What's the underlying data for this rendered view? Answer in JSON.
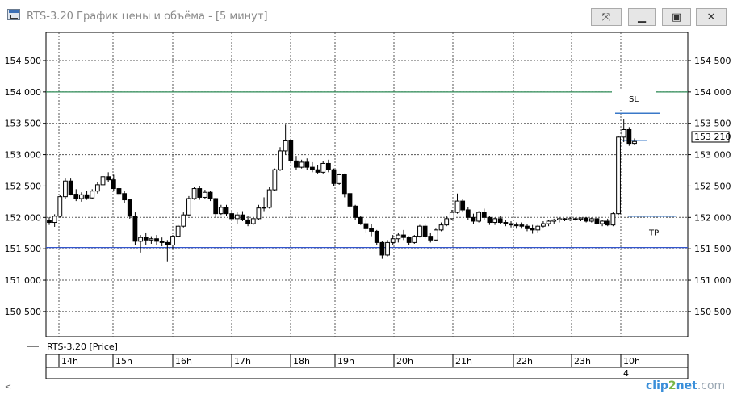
{
  "window": {
    "title": "RTS-3.20 График цены и объёма - [5 минут]",
    "buttons": {
      "pin": "⤧",
      "minimize": "▁",
      "maximize": "▣",
      "close": "✕"
    }
  },
  "legend": {
    "series_label": "RTS-3.20 [Price]"
  },
  "footer": {
    "bottom_label": "4"
  },
  "watermark": {
    "part1": "clip",
    "part2": "2",
    "part3": "net",
    "part4": ".com"
  },
  "chart_data": {
    "type": "candlestick",
    "y_ticks": [
      150500,
      151000,
      151500,
      152000,
      152500,
      153000,
      153500,
      154000,
      154500
    ],
    "y_tick_labels": [
      "150 500",
      "151 000",
      "151 500",
      "152 000",
      "152 500",
      "153 000",
      "153 500",
      "154 000",
      "154 500"
    ],
    "ylim": [
      150100,
      154950
    ],
    "grid": true,
    "x_sessions": [
      "14h",
      "15h",
      "16h",
      "17h",
      "18h",
      "19h",
      "20h",
      "21h",
      "22h",
      "23h",
      "10h"
    ],
    "last_price": 153210,
    "last_price_label": "153 210",
    "reference_lines": [
      {
        "name": "green-level",
        "value": 154000,
        "color": "#2e8b57"
      },
      {
        "name": "blue-level",
        "value": 151520,
        "color": "#3355cc"
      }
    ],
    "order_levels": [
      {
        "label": "SL",
        "value": 153660,
        "color": "#3a78c8"
      },
      {
        "label": "",
        "value": 153230,
        "color": "#3a78c8"
      },
      {
        "label": "TP",
        "value": 152020,
        "color": "#3a78c8"
      }
    ],
    "candles": [
      [
        151950,
        152000,
        151880,
        151920
      ],
      [
        151920,
        152050,
        151850,
        152020
      ],
      [
        152020,
        152360,
        152000,
        152330
      ],
      [
        152330,
        152620,
        152300,
        152580
      ],
      [
        152580,
        152620,
        152350,
        152370
      ],
      [
        152370,
        152450,
        152260,
        152300
      ],
      [
        152300,
        152400,
        152250,
        152360
      ],
      [
        152360,
        152420,
        152280,
        152310
      ],
      [
        152310,
        152450,
        152300,
        152420
      ],
      [
        152420,
        152560,
        152380,
        152520
      ],
      [
        152520,
        152690,
        152480,
        152650
      ],
      [
        152650,
        152720,
        152560,
        152600
      ],
      [
        152600,
        152680,
        152420,
        152460
      ],
      [
        152460,
        152500,
        152340,
        152380
      ],
      [
        152380,
        152420,
        152230,
        152280
      ],
      [
        152280,
        152300,
        151980,
        152020
      ],
      [
        152020,
        152080,
        151560,
        151620
      ],
      [
        151620,
        151720,
        151440,
        151680
      ],
      [
        151680,
        151760,
        151560,
        151640
      ],
      [
        151640,
        151700,
        151580,
        151660
      ],
      [
        151660,
        151720,
        151560,
        151620
      ],
      [
        151620,
        151680,
        151540,
        151600
      ],
      [
        151600,
        151640,
        151300,
        151560
      ],
      [
        151560,
        151720,
        151500,
        151700
      ],
      [
        151700,
        151880,
        151680,
        151860
      ],
      [
        151860,
        152080,
        151840,
        152040
      ],
      [
        152040,
        152340,
        152020,
        152300
      ],
      [
        152300,
        152480,
        152280,
        152460
      ],
      [
        152460,
        152500,
        152280,
        152320
      ],
      [
        152320,
        152440,
        152300,
        152400
      ],
      [
        152400,
        152420,
        152260,
        152300
      ],
      [
        152300,
        152310,
        152000,
        152060
      ],
      [
        152060,
        152200,
        152040,
        152160
      ],
      [
        152160,
        152200,
        152020,
        152060
      ],
      [
        152060,
        152100,
        151960,
        151980
      ],
      [
        151980,
        152080,
        151900,
        152040
      ],
      [
        152040,
        152100,
        151940,
        151960
      ],
      [
        151960,
        152020,
        151860,
        151900
      ],
      [
        151900,
        152000,
        151880,
        151980
      ],
      [
        151980,
        152200,
        151960,
        152150
      ],
      [
        152150,
        152320,
        152100,
        152160
      ],
      [
        152160,
        152480,
        152140,
        152440
      ],
      [
        152440,
        152780,
        152420,
        152760
      ],
      [
        152760,
        153120,
        152740,
        153060
      ],
      [
        153060,
        153480,
        153000,
        153220
      ],
      [
        153220,
        153260,
        152860,
        152900
      ],
      [
        152900,
        152980,
        152760,
        152800
      ],
      [
        152800,
        152920,
        152780,
        152880
      ],
      [
        152880,
        152940,
        152760,
        152800
      ],
      [
        152800,
        152880,
        152720,
        152760
      ],
      [
        152760,
        152840,
        152700,
        152720
      ],
      [
        152720,
        152900,
        152700,
        152860
      ],
      [
        152860,
        152920,
        152720,
        152760
      ],
      [
        152760,
        152780,
        152500,
        152540
      ],
      [
        152540,
        152700,
        152520,
        152680
      ],
      [
        152680,
        152700,
        152320,
        152380
      ],
      [
        152380,
        152420,
        152140,
        152180
      ],
      [
        152180,
        152200,
        151960,
        152000
      ],
      [
        152000,
        152020,
        151880,
        151900
      ],
      [
        151900,
        151960,
        151760,
        151820
      ],
      [
        151820,
        151900,
        151700,
        151780
      ],
      [
        151780,
        151800,
        151560,
        151600
      ],
      [
        151600,
        151620,
        151340,
        151400
      ],
      [
        151400,
        151640,
        151380,
        151600
      ],
      [
        151600,
        151720,
        151560,
        151660
      ],
      [
        151660,
        151760,
        151600,
        151720
      ],
      [
        151720,
        151800,
        151640,
        151680
      ],
      [
        151680,
        151700,
        151560,
        151600
      ],
      [
        151600,
        151720,
        151580,
        151700
      ],
      [
        151700,
        151880,
        151680,
        151860
      ],
      [
        151860,
        151900,
        151660,
        151700
      ],
      [
        151700,
        151760,
        151600,
        151640
      ],
      [
        151640,
        151820,
        151620,
        151800
      ],
      [
        151800,
        151920,
        151780,
        151880
      ],
      [
        151880,
        152020,
        151860,
        151980
      ],
      [
        151980,
        152120,
        151960,
        152080
      ],
      [
        152080,
        152380,
        152060,
        152260
      ],
      [
        152260,
        152300,
        152080,
        152120
      ],
      [
        152120,
        152160,
        151960,
        152000
      ],
      [
        152000,
        152060,
        151900,
        151940
      ],
      [
        151940,
        152100,
        151920,
        152080
      ],
      [
        152080,
        152140,
        151960,
        152000
      ],
      [
        152000,
        152020,
        151880,
        151920
      ],
      [
        151920,
        152000,
        151880,
        151980
      ],
      [
        151980,
        152020,
        151900,
        151920
      ],
      [
        151920,
        151960,
        151860,
        151900
      ],
      [
        151900,
        151940,
        151840,
        151880
      ],
      [
        151880,
        151920,
        151820,
        151880
      ],
      [
        151880,
        151920,
        151820,
        151860
      ],
      [
        151860,
        151900,
        151780,
        151820
      ],
      [
        151820,
        151880,
        151740,
        151800
      ],
      [
        151800,
        151880,
        151760,
        151860
      ],
      [
        151860,
        151940,
        151840,
        151900
      ],
      [
        151900,
        151960,
        151860,
        151940
      ],
      [
        151940,
        151980,
        151900,
        151960
      ],
      [
        151960,
        152000,
        151920,
        151980
      ],
      [
        151980,
        151990,
        151940,
        151960
      ],
      [
        151960,
        152000,
        151940,
        151980
      ],
      [
        151980,
        152000,
        151950,
        151970
      ],
      [
        151970,
        152000,
        151940,
        151990
      ],
      [
        151990,
        152000,
        151920,
        151940
      ],
      [
        151940,
        152000,
        151920,
        151980
      ],
      [
        151980,
        151990,
        151880,
        151900
      ],
      [
        151900,
        151960,
        151860,
        151940
      ],
      [
        151940,
        151980,
        151860,
        151880
      ],
      [
        151880,
        152080,
        151860,
        152060
      ],
      [
        152060,
        153300,
        152040,
        153280
      ],
      [
        153280,
        153560,
        153200,
        153400
      ],
      [
        153400,
        153440,
        153140,
        153180
      ],
      [
        153180,
        153260,
        153160,
        153210
      ]
    ]
  }
}
